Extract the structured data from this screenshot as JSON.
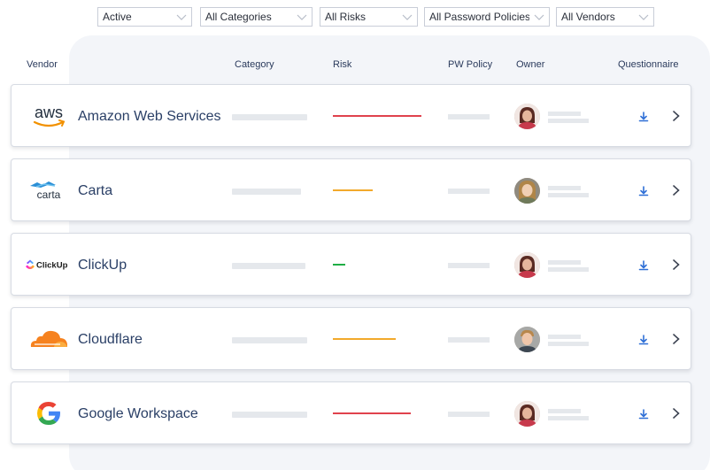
{
  "filters": [
    {
      "label": "Active"
    },
    {
      "label": "All Categories"
    },
    {
      "label": "All Risks"
    },
    {
      "label": "All Password Policies"
    },
    {
      "label": "All Vendors"
    }
  ],
  "columns": {
    "vendor": "Vendor",
    "category": "Category",
    "risk": "Risk",
    "pw_policy": "PW Policy",
    "owner": "Owner",
    "questionnaire": "Questionnaire"
  },
  "vendors": [
    {
      "name": "Amazon Web Services",
      "logo_text": "aws",
      "logo": "aws-logo",
      "risk_color": "#e0424d"
    },
    {
      "name": "Carta",
      "logo_text": "carta",
      "logo": "carta-logo",
      "risk_color": "#f2a92b"
    },
    {
      "name": "ClickUp",
      "logo_text": "ClickUp",
      "logo": "clickup-logo",
      "risk_color": "#1fae45"
    },
    {
      "name": "Cloudflare",
      "logo": "cloudflare-logo",
      "risk_color": "#f2a92b"
    },
    {
      "name": "Google Workspace",
      "logo": "google-logo",
      "risk_color": "#e0424d"
    }
  ],
  "icons": {
    "filter_chevron": "chevron-down-icon",
    "download": "download-icon",
    "row_arrow": "chevron-right-icon"
  },
  "colors": {
    "accent": "#2f6fd6",
    "text": "#2a3f66",
    "placeholder": "#e5e8ec"
  }
}
